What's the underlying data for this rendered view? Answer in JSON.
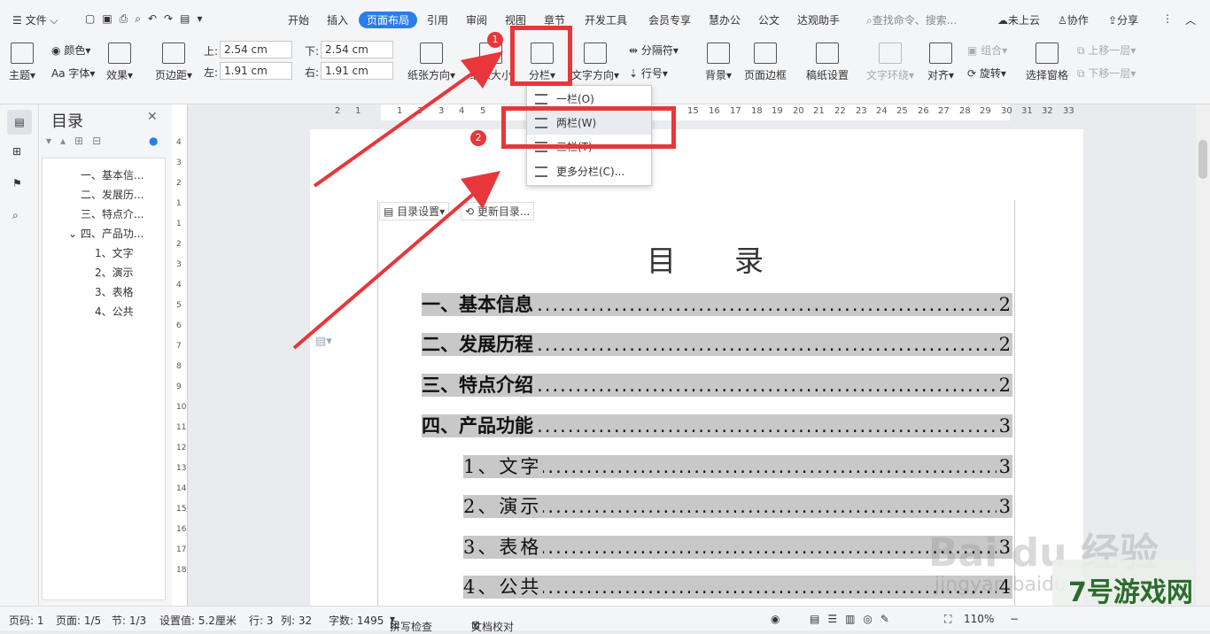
{
  "menubar": {
    "file": "文件",
    "tabs": [
      "开始",
      "插入",
      "页面布局",
      "引用",
      "审阅",
      "视图",
      "章节",
      "开发工具",
      "会员专享",
      "慧办公",
      "公文",
      "达观助手"
    ],
    "search": "查找命令、搜索...",
    "cloud": "未上云",
    "collab": "协作",
    "share": "分享"
  },
  "ribbon": {
    "theme": "主题",
    "color": "颜色",
    "font": "Aa 字体",
    "effect": "效果",
    "margins": "页边距",
    "top_label": "上:",
    "top_value": "2.54 cm",
    "bottom_label": "下:",
    "bottom_value": "2.54 cm",
    "left_label": "左:",
    "left_value": "1.91 cm",
    "right_label": "右:",
    "right_value": "1.91 cm",
    "orientation": "纸张方向",
    "size": "纸张大小",
    "columns": "分栏",
    "text_dir": "文字方向",
    "break": "分隔符",
    "line_num": "行号",
    "background": "背景",
    "border": "页面边框",
    "draft": "稿纸设置",
    "wrap": "文字环绕",
    "align": "对齐",
    "group": "组合",
    "rotate": "旋转",
    "select_pane": "选择窗格",
    "bring_fwd": "上移一层",
    "send_back": "下移一层"
  },
  "columns_menu": {
    "one": "一栏(O)",
    "two": "两栏(W)",
    "three": "三栏(T)",
    "more": "更多分栏(C)..."
  },
  "toc_panel": {
    "title": "目录",
    "items": [
      "一、基本信...",
      "二、发展历...",
      "三、特点介...",
      "四、产品功...",
      "1、文字",
      "2、演示",
      "3、表格",
      "4、公共"
    ]
  },
  "toc_toolbar": {
    "settings": "目录设置",
    "update": "更新目录..."
  },
  "document": {
    "title": "目　　录",
    "entries": [
      {
        "text": "一、基本信息",
        "page": "2"
      },
      {
        "text": "二、发展历程",
        "page": "2"
      },
      {
        "text": "三、特点介绍",
        "page": "2"
      },
      {
        "text": "四、产品功能",
        "page": "3"
      },
      {
        "text": "1、文字",
        "page": "3"
      },
      {
        "text": "2、演示",
        "page": "3"
      },
      {
        "text": "3、表格",
        "page": "3"
      },
      {
        "text": "4、公共",
        "page": "4"
      }
    ]
  },
  "hruler": [
    "2",
    "1",
    "1",
    "2",
    "3",
    "4",
    "5",
    "15",
    "16",
    "17",
    "18",
    "19",
    "20",
    "21",
    "22",
    "23",
    "24",
    "25",
    "26",
    "27",
    "28",
    "29",
    "30",
    "31",
    "32",
    "33"
  ],
  "vruler": [
    "4",
    "3",
    "2",
    "1",
    "1",
    "2",
    "3",
    "4",
    "5",
    "6",
    "7",
    "8",
    "9",
    "10",
    "11",
    "12",
    "13",
    "14",
    "15",
    "16",
    "17",
    "18"
  ],
  "badges": [
    "1",
    "2"
  ],
  "status": {
    "page_code": "页码: 1",
    "pages": "页面: 1/5",
    "section": "节: 1/3",
    "setting": "设置值: 5.2厘米",
    "row": "行: 3",
    "col": "列: 32",
    "words": "字数: 1495",
    "spell": "拼写检查",
    "proof": "文档校对",
    "zoom": "110%"
  },
  "watermark": {
    "baidu": "Bai du 经验",
    "url": "jingyan.baidu",
    "site": "7号游戏网"
  },
  "colors": {
    "accent": "#2b7de9",
    "red": "#e8363a",
    "highlight": "#c8c8c8"
  }
}
